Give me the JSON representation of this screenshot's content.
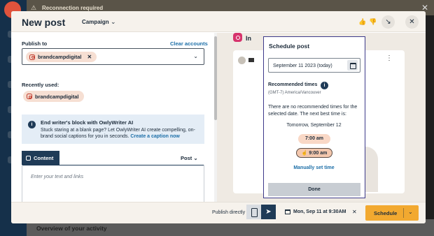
{
  "background": {
    "banner": "Reconnection required",
    "bottom_text": "Overview of your activity"
  },
  "header": {
    "title": "New post",
    "campaign_label": "Campaign"
  },
  "publish": {
    "label": "Publish to",
    "clear_accounts": "Clear accounts",
    "selected_account": "brandcampdigital",
    "recently_used_label": "Recently used:",
    "recent_account": "brandcampdigital"
  },
  "owlywriter": {
    "title": "End writer's block with OwlyWriter AI",
    "body": "Stuck staring at a blank page? Let OwlyWriter AI create compelling, on-brand social captions for you in seconds.",
    "link": "Create a caption now"
  },
  "content": {
    "tab_label": "Content",
    "post_type": "Post",
    "placeholder": "Enter your text and links"
  },
  "preview": {
    "network_label": "In"
  },
  "schedule": {
    "title": "Schedule post",
    "date_value": "September 11 2023 (today)",
    "recommended_title": "Recommended times",
    "timezone": "(GMT-7) America/Vancouver",
    "message": "There are no recommended times for the selected date. The next best time is:",
    "next_date": "Tomorrow, September 12",
    "times": [
      "7:00 am",
      "9:00 am"
    ],
    "manual_link": "Manually set time",
    "done_label": "Done"
  },
  "footer": {
    "publish_directly": "Publish directly",
    "scheduled_when": "Mon, Sep 11 at 9:30AM",
    "schedule_button": "Schedule"
  }
}
